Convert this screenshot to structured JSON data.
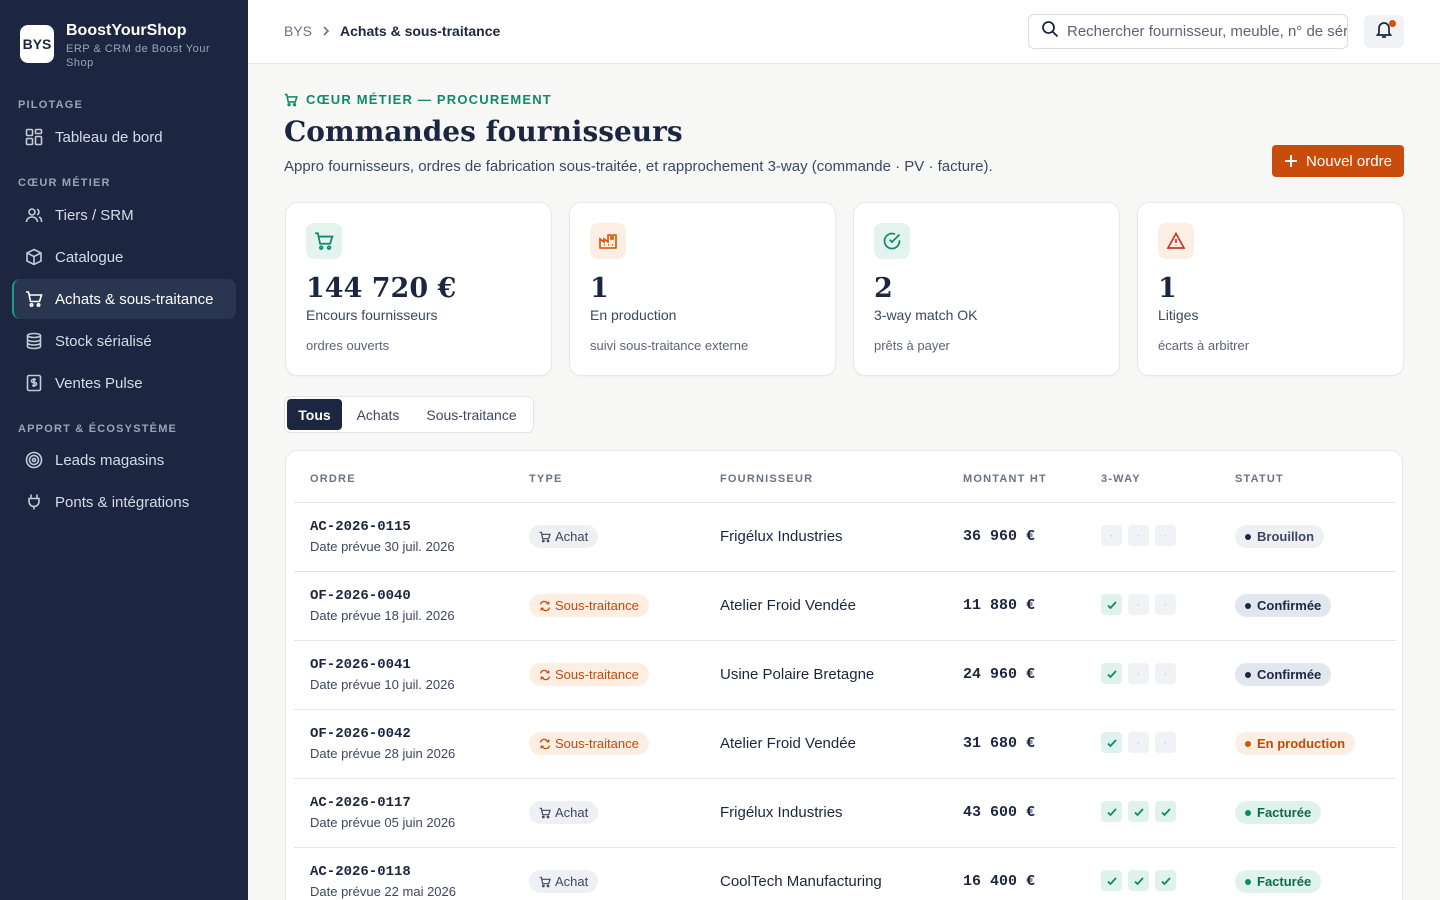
{
  "brand": {
    "logo": "BYS",
    "name": "BoostYourShop",
    "subtitle": "ERP & CRM de Boost Your Shop"
  },
  "sidebar": {
    "sections": [
      {
        "title": "PILOTAGE"
      },
      {
        "title": "CŒUR MÉTIER"
      },
      {
        "title": "APPORT & ÉCOSYSTÈME"
      }
    ],
    "items": [
      {
        "label": "Tableau de bord",
        "icon": "dashboard-icon"
      },
      {
        "label": "Tiers / SRM",
        "icon": "users-icon"
      },
      {
        "label": "Catalogue",
        "icon": "box-icon"
      },
      {
        "label": "Achats & sous-traitance",
        "icon": "cart-icon",
        "active": true
      },
      {
        "label": "Stock sérialisé",
        "icon": "database-icon"
      },
      {
        "label": "Ventes Pulse",
        "icon": "receipt-icon"
      },
      {
        "label": "Leads magasins",
        "icon": "target-icon"
      },
      {
        "label": "Ponts & intégrations",
        "icon": "plug-icon"
      }
    ]
  },
  "topbar": {
    "breadcrumb": [
      "BYS",
      "Achats & sous-traitance"
    ],
    "search_placeholder": "Rechercher fournisseur, meuble, n° de série…",
    "notification_dot": true
  },
  "header": {
    "eyebrow": "CŒUR MÉTIER — PROCUREMENT",
    "title": "Commandes fournisseurs",
    "subtitle": "Appro fournisseurs, ordres de fabrication sous-traitée, et rapprochement 3-way (commande · PV · facture).",
    "new_button": "Nouvel ordre"
  },
  "kpis": [
    {
      "value": "144 720 €",
      "label": "Encours fournisseurs",
      "hint": "ordres ouverts",
      "icon": "cart-icon",
      "color": "#0e8a6a",
      "bg": "#e3f4ee"
    },
    {
      "value": "1",
      "label": "En production",
      "hint": "suivi sous-traitance externe",
      "icon": "factory-icon",
      "color": "#d35400",
      "bg": "#fdeee4"
    },
    {
      "value": "2",
      "label": "3-way match OK",
      "hint": "prêts à payer",
      "icon": "check-circle-icon",
      "color": "#0e8a6a",
      "bg": "#e3f4ee"
    },
    {
      "value": "1",
      "label": "Litiges",
      "hint": "écarts à arbitrer",
      "icon": "warning-icon",
      "color": "#c0392b",
      "bg": "#fdeee4"
    }
  ],
  "tabs": [
    {
      "label": "Tous",
      "active": true
    },
    {
      "label": "Achats",
      "active": false
    },
    {
      "label": "Sous-traitance",
      "active": false
    }
  ],
  "table": {
    "columns": [
      "ORDRE",
      "TYPE",
      "FOURNISSEUR",
      "MONTANT HT",
      "3-WAY",
      "STATUT"
    ],
    "rows": [
      {
        "id": "AC-2026-0115",
        "date": "Date prévue 30 juil. 2026",
        "type": "Achat",
        "supplier": "Frigélux Industries",
        "amount": "36 960 €",
        "way": [
          false,
          false,
          false
        ],
        "status": "Brouillon"
      },
      {
        "id": "OF-2026-0040",
        "date": "Date prévue 18 juil. 2026",
        "type": "Sous-traitance",
        "supplier": "Atelier Froid Vendée",
        "amount": "11 880 €",
        "way": [
          true,
          false,
          false
        ],
        "status": "Confirmée"
      },
      {
        "id": "OF-2026-0041",
        "date": "Date prévue 10 juil. 2026",
        "type": "Sous-traitance",
        "supplier": "Usine Polaire Bretagne",
        "amount": "24 960 €",
        "way": [
          true,
          false,
          false
        ],
        "status": "Confirmée"
      },
      {
        "id": "OF-2026-0042",
        "date": "Date prévue 28 juin 2026",
        "type": "Sous-traitance",
        "supplier": "Atelier Froid Vendée",
        "amount": "31 680 €",
        "way": [
          true,
          false,
          false
        ],
        "status": "En production"
      },
      {
        "id": "AC-2026-0117",
        "date": "Date prévue 05 juin 2026",
        "type": "Achat",
        "supplier": "Frigélux Industries",
        "amount": "43 600 €",
        "way": [
          true,
          true,
          true
        ],
        "status": "Facturée"
      },
      {
        "id": "AC-2026-0118",
        "date": "Date prévue 22 mai 2026",
        "type": "Achat",
        "supplier": "CoolTech Manufacturing",
        "amount": "16 400 €",
        "way": [
          true,
          true,
          true
        ],
        "status": "Facturée"
      }
    ],
    "empty_mark": "·"
  },
  "status_styles": {
    "Brouillon": {
      "bg": "#eef0f3",
      "fg": "#3d4760",
      "dot": "#1c2640"
    },
    "Confirmée": {
      "bg": "#e2e6ee",
      "fg": "#1c2640",
      "dot": "#1c2640"
    },
    "En production": {
      "bg": "#fdeee4",
      "fg": "#c24a0a",
      "dot": "#d35400"
    },
    "Facturée": {
      "bg": "#dff3ec",
      "fg": "#0e6b52",
      "dot": "#0e8a6a"
    }
  }
}
